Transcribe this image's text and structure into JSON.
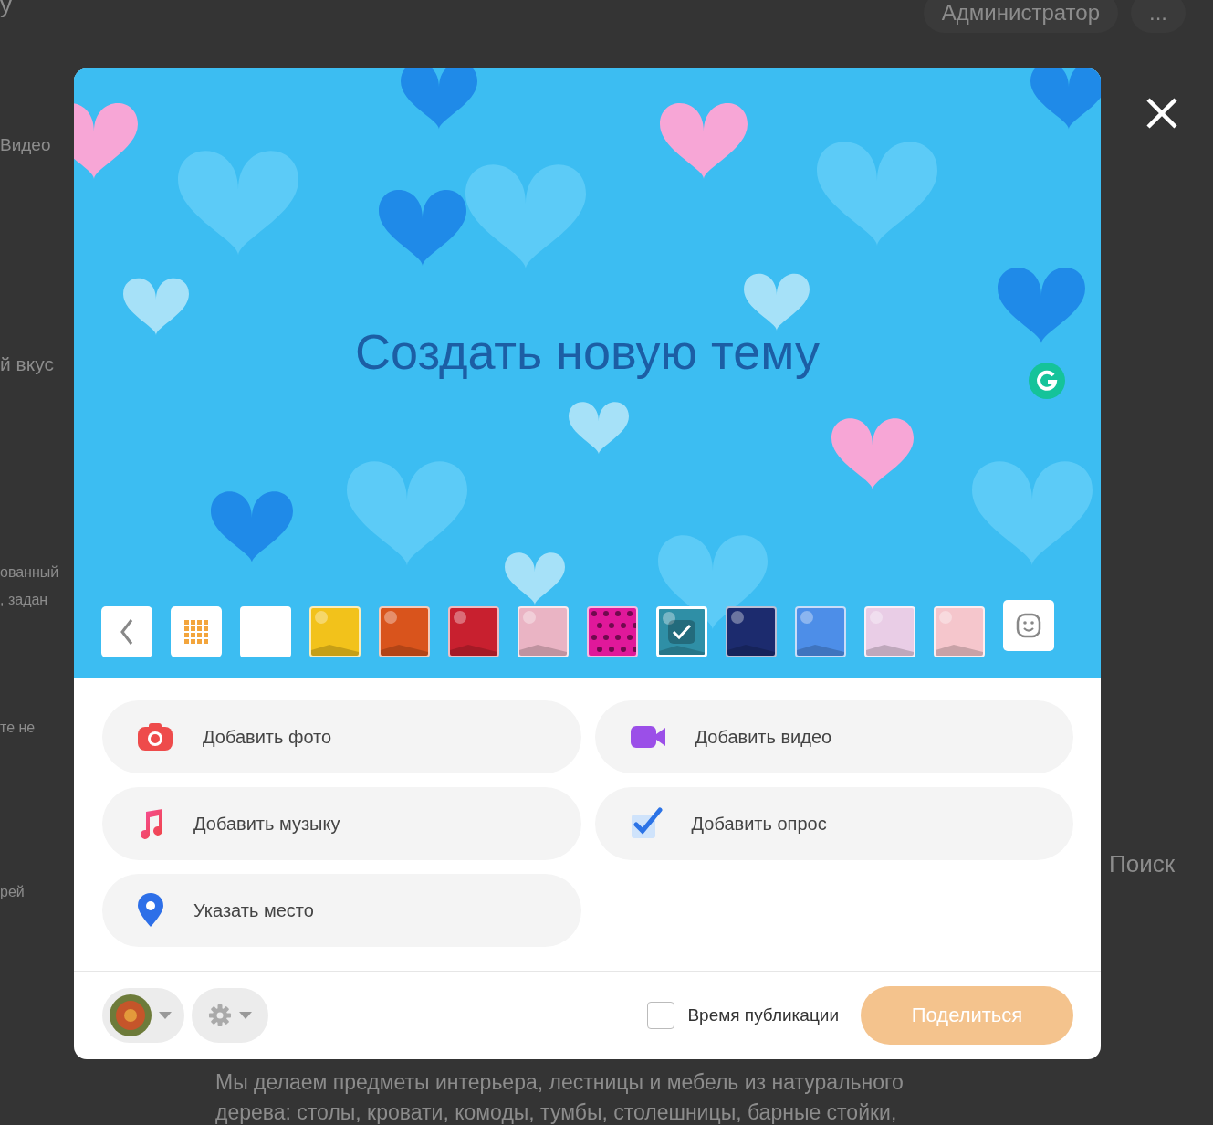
{
  "background_page": {
    "top_fragment": "у",
    "admin_button": "Администратор",
    "more_button": "...",
    "tab_fragment": "Видео",
    "heading_fragment": "й вкус",
    "left_fragments": [
      "ованный",
      ", задан",
      "те не",
      "рей"
    ],
    "search_tab": "Поиск",
    "description": [
      "Мы делаем предметы интерьера, лестницы и мебель из натурального",
      "дерева: столы, кровати, комоды, тумбы, столешницы, барные стойки,"
    ]
  },
  "modal": {
    "title": "Создать новую тему",
    "swatches": [
      {
        "kind": "white",
        "color": "#ffffff",
        "selected": false
      },
      {
        "kind": "photo",
        "color": "#f2c21b",
        "selected": false
      },
      {
        "kind": "photo",
        "color": "#d9541c",
        "selected": false
      },
      {
        "kind": "photo",
        "color": "#c8202f",
        "selected": false
      },
      {
        "kind": "photo",
        "color": "#eab4c4",
        "selected": false
      },
      {
        "kind": "pattern",
        "color": "#e0189a",
        "selected": false
      },
      {
        "kind": "photo",
        "color": "#2f8fa6",
        "selected": true
      },
      {
        "kind": "photo",
        "color": "#1c2b6e",
        "selected": false
      },
      {
        "kind": "photo",
        "color": "#4d8ee8",
        "selected": false
      },
      {
        "kind": "photo",
        "color": "#e9cde6",
        "selected": false
      },
      {
        "kind": "photo",
        "color": "#f5c6cc",
        "selected": false
      }
    ],
    "actions": [
      {
        "kind": "photo",
        "label": "Добавить фото"
      },
      {
        "kind": "video",
        "label": "Добавить видео"
      },
      {
        "kind": "music",
        "label": "Добавить музыку"
      },
      {
        "kind": "poll",
        "label": "Добавить опрос"
      },
      {
        "kind": "place",
        "label": "Указать место"
      }
    ],
    "footer": {
      "schedule": {
        "label": "Время публикации",
        "checked": false
      },
      "share_button": "Поделиться"
    }
  }
}
